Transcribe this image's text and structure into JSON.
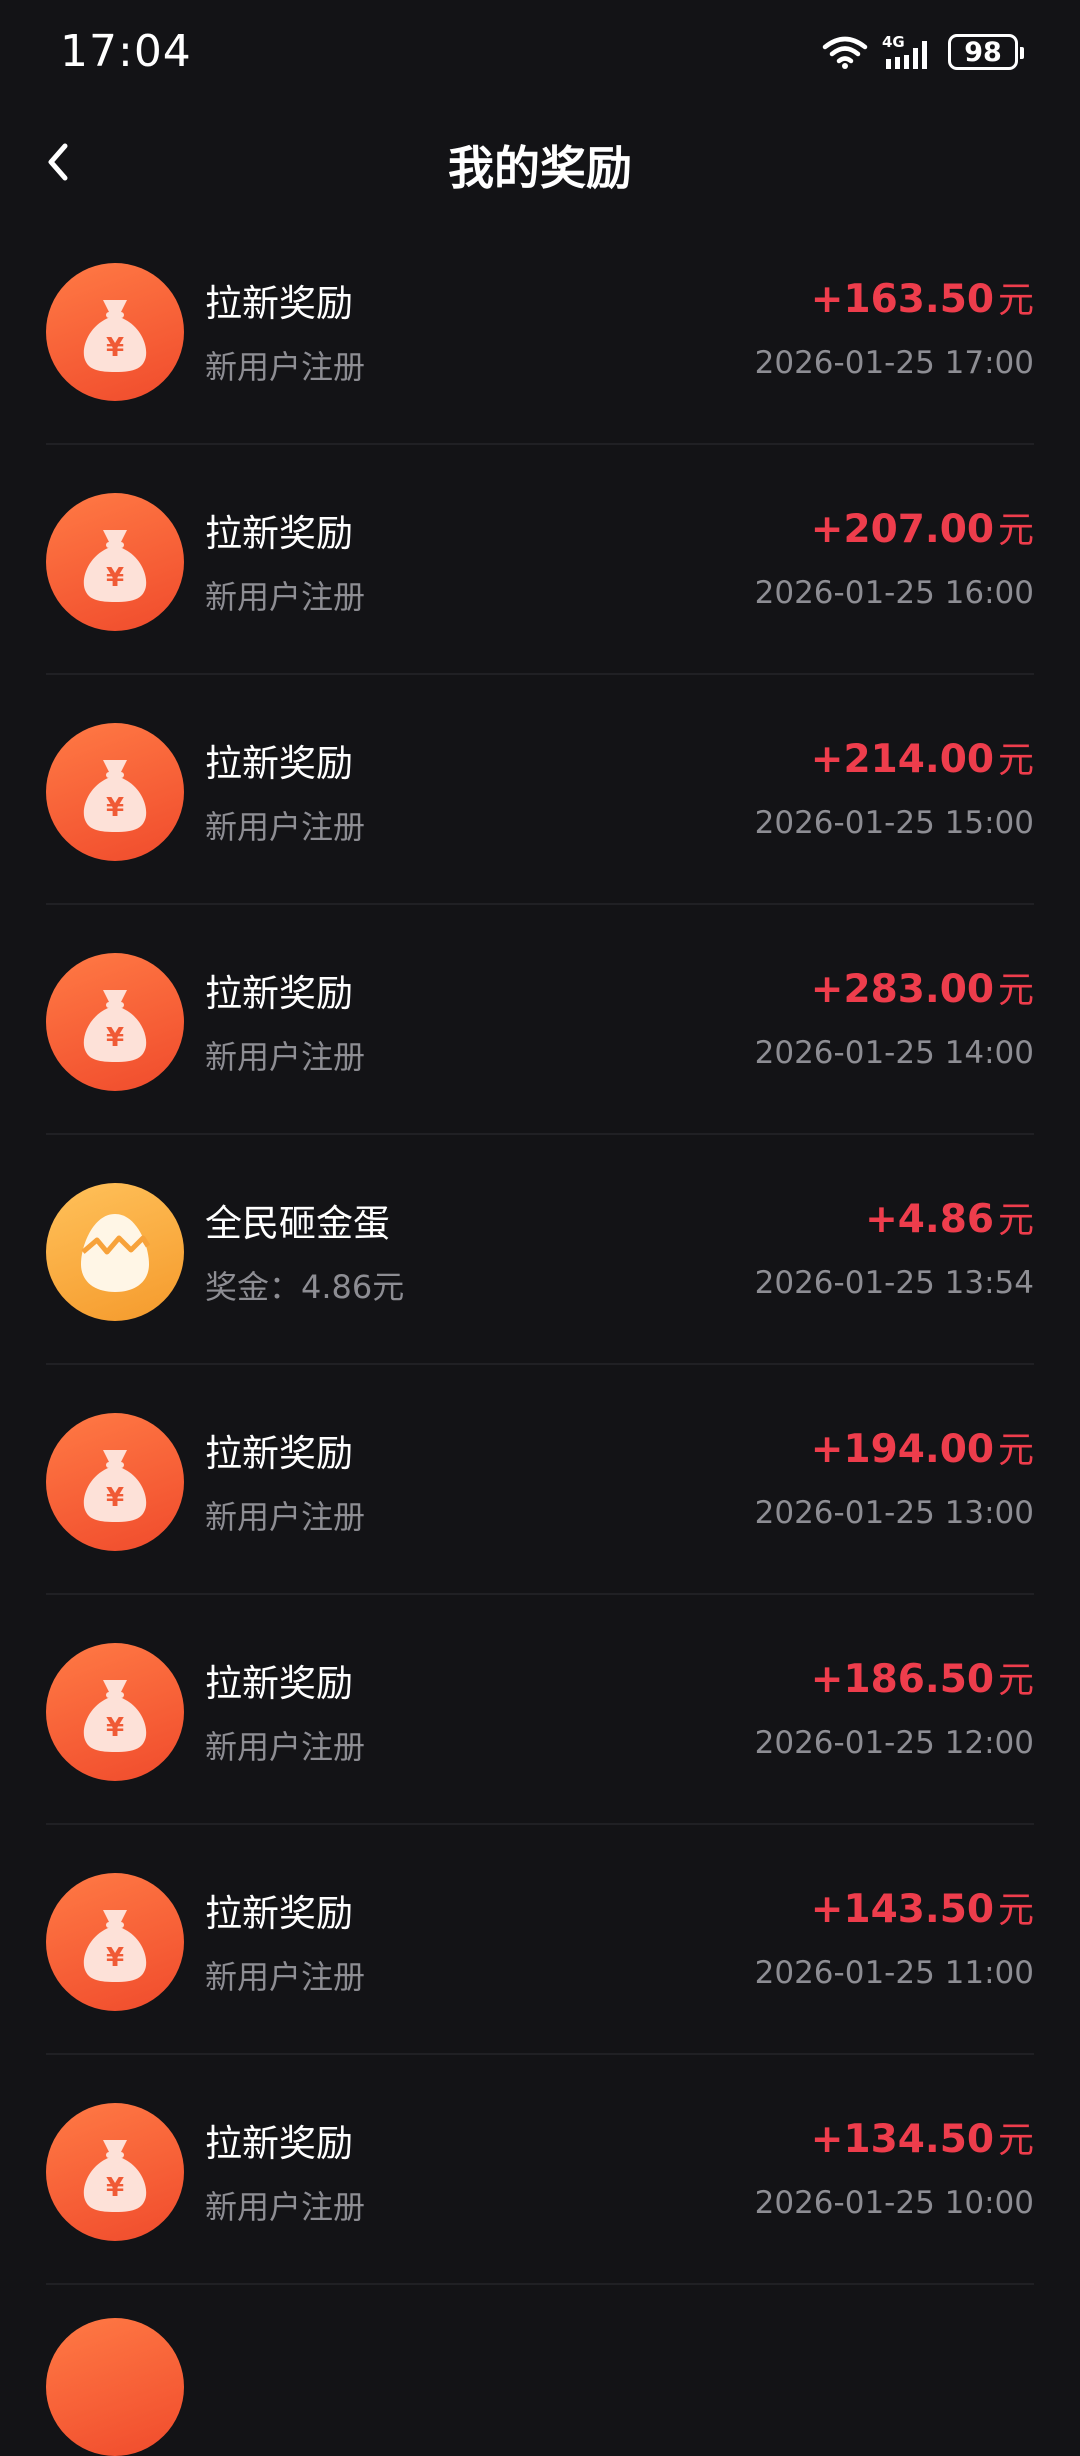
{
  "status_bar": {
    "time": "17:04",
    "network_label": "4G",
    "battery": "98"
  },
  "header": {
    "title": "我的奖励"
  },
  "colors": {
    "background": "#131316",
    "amount_red": "#ee3d4c",
    "bag_icon_bg": "#f25a33",
    "egg_icon_bg": "#f8ac42",
    "secondary_text": "#8d8d93"
  },
  "rewards": [
    {
      "icon": "money-bag-icon",
      "title": "拉新奖励",
      "subtitle": "新用户注册",
      "amount": "+163.50",
      "unit": "元",
      "time": "2026-01-25 17:00"
    },
    {
      "icon": "money-bag-icon",
      "title": "拉新奖励",
      "subtitle": "新用户注册",
      "amount": "+207.00",
      "unit": "元",
      "time": "2026-01-25 16:00"
    },
    {
      "icon": "money-bag-icon",
      "title": "拉新奖励",
      "subtitle": "新用户注册",
      "amount": "+214.00",
      "unit": "元",
      "time": "2026-01-25 15:00"
    },
    {
      "icon": "money-bag-icon",
      "title": "拉新奖励",
      "subtitle": "新用户注册",
      "amount": "+283.00",
      "unit": "元",
      "time": "2026-01-25 14:00"
    },
    {
      "icon": "golden-egg-icon",
      "title": "全民砸金蛋",
      "subtitle": "奖金：4.86元",
      "amount": "+4.86",
      "unit": "元",
      "time": "2026-01-25 13:54"
    },
    {
      "icon": "money-bag-icon",
      "title": "拉新奖励",
      "subtitle": "新用户注册",
      "amount": "+194.00",
      "unit": "元",
      "time": "2026-01-25 13:00"
    },
    {
      "icon": "money-bag-icon",
      "title": "拉新奖励",
      "subtitle": "新用户注册",
      "amount": "+186.50",
      "unit": "元",
      "time": "2026-01-25 12:00"
    },
    {
      "icon": "money-bag-icon",
      "title": "拉新奖励",
      "subtitle": "新用户注册",
      "amount": "+143.50",
      "unit": "元",
      "time": "2026-01-25 11:00"
    },
    {
      "icon": "money-bag-icon",
      "title": "拉新奖励",
      "subtitle": "新用户注册",
      "amount": "+134.50",
      "unit": "元",
      "time": "2026-01-25 10:00"
    }
  ]
}
